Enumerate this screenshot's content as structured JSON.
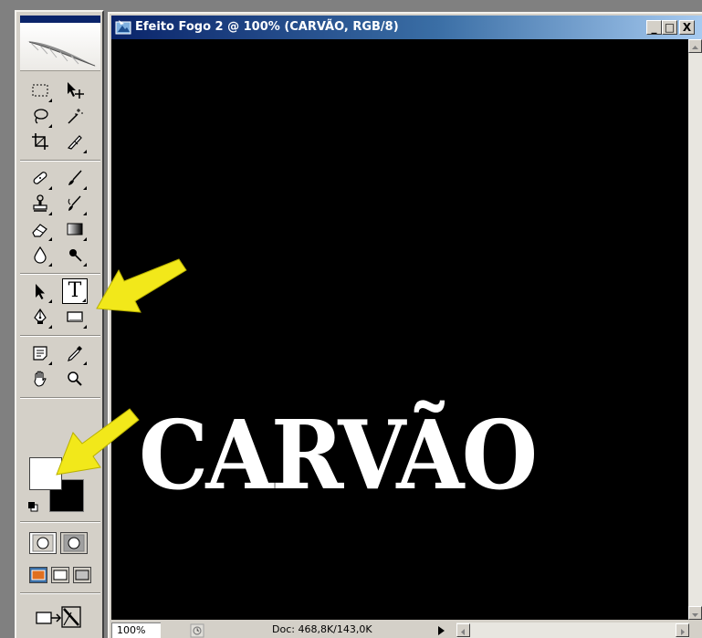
{
  "document": {
    "title": "Efeito Fogo 2 @ 100% (CARVÃO, RGB/8)",
    "canvas_text": "CARVÃO",
    "zoom": "100%",
    "doc_info": "Doc: 468,8K/143,0K"
  },
  "window_controls": {
    "minimize": "_",
    "maximize": "□",
    "close": "X"
  },
  "tools": {
    "type_tool_glyph": "T",
    "selected_tool": "type-tool"
  },
  "colors": {
    "foreground": "#ffffff",
    "background": "#000000",
    "canvas": "#000000",
    "annotation_arrow": "#f2e81a",
    "title_bar_start": "#0a246a"
  },
  "annotations": {
    "arrows": [
      "arrow-to-type-tool",
      "arrow-to-foreground-color"
    ]
  }
}
